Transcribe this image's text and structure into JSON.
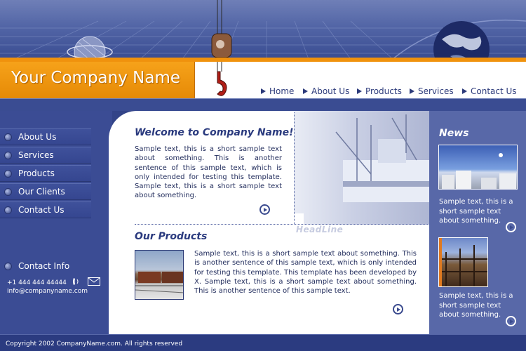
{
  "header": {
    "company_name": "Your Company Name"
  },
  "nav": {
    "items": [
      {
        "label": "Home"
      },
      {
        "label": "About Us"
      },
      {
        "label": "Products"
      },
      {
        "label": "Services"
      },
      {
        "label": "Contact Us"
      }
    ]
  },
  "sidebar": {
    "items": [
      {
        "label": "About Us"
      },
      {
        "label": "Services"
      },
      {
        "label": "Products"
      },
      {
        "label": "Our Clients"
      },
      {
        "label": "Contact Us"
      }
    ],
    "contact": {
      "title": "Contact Info",
      "phone": "+1 444 444 44444",
      "email": "info@companyname.com"
    }
  },
  "main": {
    "welcome_title": "Welcome to Company Name!",
    "welcome_text": "Sample text, this is a short sample text about something. This is another sentence of this sample text, which is only intended for testing this template. Sample text, this is a short sample text about something.",
    "headline": "HeadLine",
    "products_title": "Our Products",
    "products_text": "Sample text, this is a short sample text about something. This is another sentence of this sample text, which is only intended for testing this template. This template has been developed by X. Sample text, this is a short sample text about something. This is another sentence of this sample text."
  },
  "news": {
    "title": "News",
    "items": [
      {
        "text": "Sample text, this is a short sample text about something."
      },
      {
        "text": "Sample text, this is a short sample text about something."
      }
    ]
  },
  "footer": {
    "copyright": "Copyright 2002 CompanyName.com. All rights reserved"
  }
}
